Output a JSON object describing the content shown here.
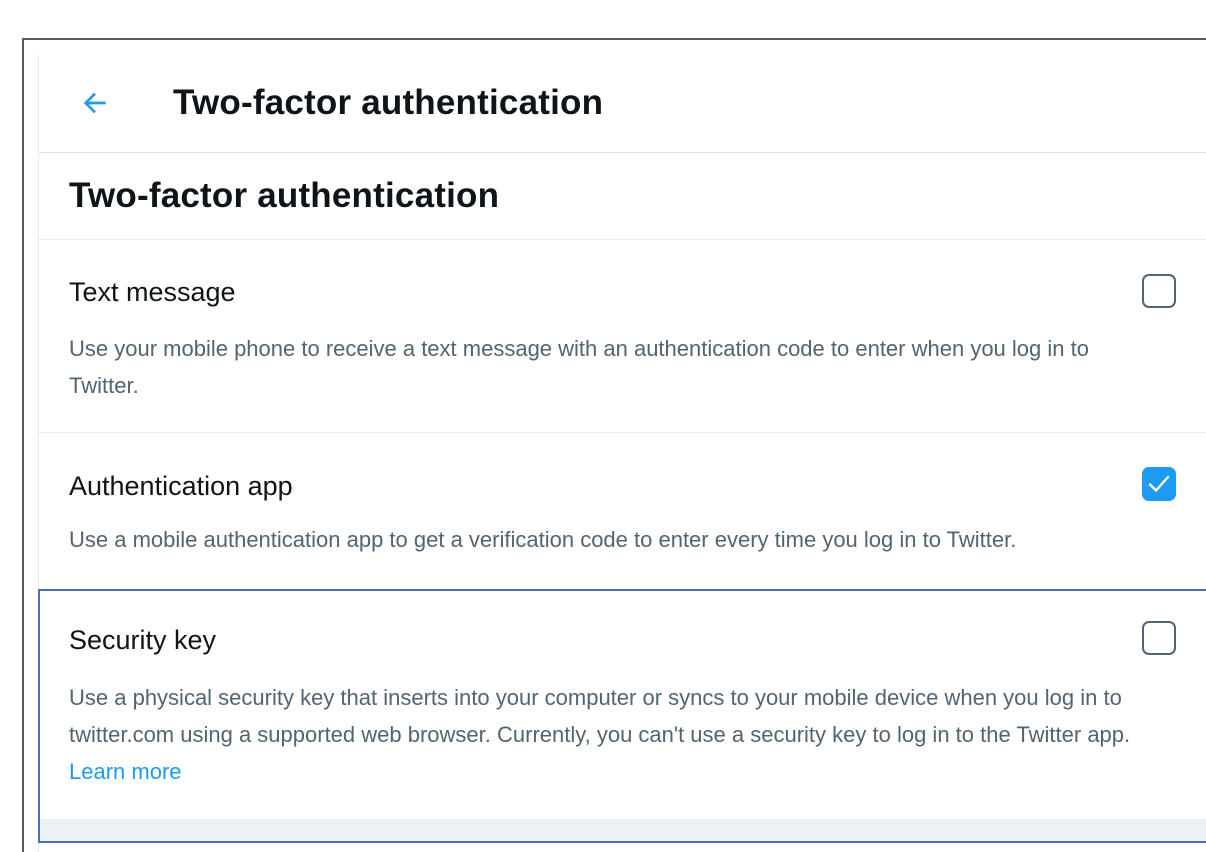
{
  "header": {
    "title": "Two-factor authentication",
    "back_icon": "arrow-left-icon"
  },
  "section": {
    "title": "Two-factor authentication"
  },
  "options": [
    {
      "label": "Text message",
      "description": "Use your mobile phone to receive a text message with an authentication code to enter when you log in to Twitter.",
      "checked": false
    },
    {
      "label": "Authentication app",
      "description": "Use a mobile authentication app to get a verification code to enter every time you log in to Twitter.",
      "checked": true
    },
    {
      "label": "Security key",
      "description": "Use a physical security key that inserts into your computer or syncs to your mobile device when you log in to twitter.com using a supported web browser. Currently, you can't use a security key to log in to the Twitter app.",
      "link_text": "Learn more",
      "checked": false
    }
  ],
  "colors": {
    "accent": "#1d9bf0",
    "text_primary": "#0f1419",
    "text_secondary": "#536471",
    "focus_border": "#4a6fb5"
  }
}
